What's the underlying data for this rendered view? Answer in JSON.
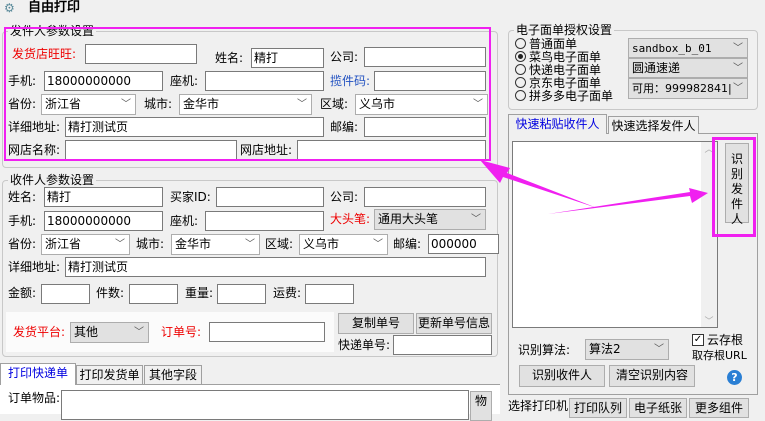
{
  "window": {
    "title": "自由打印",
    "icon": "network-icon"
  },
  "sender": {
    "legend": "发件人参数设置",
    "wangwang_label": "发货店旺旺:",
    "wangwang": "",
    "name_label": "姓名:",
    "name": "精打",
    "company_label": "公司:",
    "company": "",
    "mobile_label": "手机:",
    "mobile": "18000000000",
    "phone_label": "座机:",
    "phone": "",
    "pickup_label": "揽件码:",
    "pickup": "",
    "province_label": "省份:",
    "province": "浙江省",
    "city_label": "城市:",
    "city": "金华市",
    "district_label": "区域:",
    "district": "义乌市",
    "address_label": "详细地址:",
    "address": "精打测试页",
    "zip_label": "邮编:",
    "zip": "",
    "shop_name_label": "网店名称:",
    "shop_name": "",
    "shop_url_label": "网店地址:",
    "shop_url": ""
  },
  "receiver": {
    "legend": "收件人参数设置",
    "name_label": "姓名:",
    "name": "精打",
    "buyer_label": "买家ID:",
    "buyer": "",
    "company_label": "公司:",
    "company": "",
    "mobile_label": "手机:",
    "mobile": "18000000000",
    "phone_label": "座机:",
    "phone": "",
    "bigpen_label": "大头笔:",
    "bigpen": "通用大头笔",
    "province_label": "省份:",
    "province": "浙江省",
    "city_label": "城市:",
    "city": "金华市",
    "district_label": "区域:",
    "district": "义乌市",
    "zip_label": "邮编:",
    "zip": "000000",
    "address_label": "详细地址:",
    "address": "精打测试页",
    "amount_label": "金额:",
    "count_label": "件数:",
    "weight_label": "重量:",
    "freight_label": "运费:",
    "platform_label": "发货平台:",
    "platform": "其他",
    "order_label": "订单号:",
    "order": "",
    "copy_btn": "复制单号",
    "update_btn": "更新单号信息",
    "tracking_label": "快递单号:",
    "tracking": ""
  },
  "bottom_tabs": [
    "打印快递单",
    "打印发货单",
    "其他字段"
  ],
  "items_label": "订单物品:",
  "items_btn": "物",
  "auth": {
    "legend": "电子面单授权设置",
    "options": [
      "普通面单",
      "菜鸟电子面单",
      "快递电子面单",
      "京东电子面单",
      "拼多多电子面单"
    ],
    "selected": 1,
    "account": "sandbox_b_01",
    "courier": "圆通速递",
    "available": "可用：999982841|"
  },
  "right_tabs": [
    "快速粘贴收件人",
    "快速选择发件人"
  ],
  "recognize_sender": "识别发件人",
  "algo_label": "识别算法:",
  "algo": "算法2",
  "cloud_label": "云存根",
  "cloud_checked": true,
  "stub_url": "取存根URL",
  "recognize_receiver": "识别收件人",
  "clear_btn": "清空识别内容",
  "printer_label": "选择打印机：",
  "printer_btns": [
    "打印队列",
    "电子纸张",
    "更多组件"
  ],
  "colors": {
    "highlight": "#f020f0",
    "active_tab": "#0000e0",
    "required": "#e00000"
  }
}
